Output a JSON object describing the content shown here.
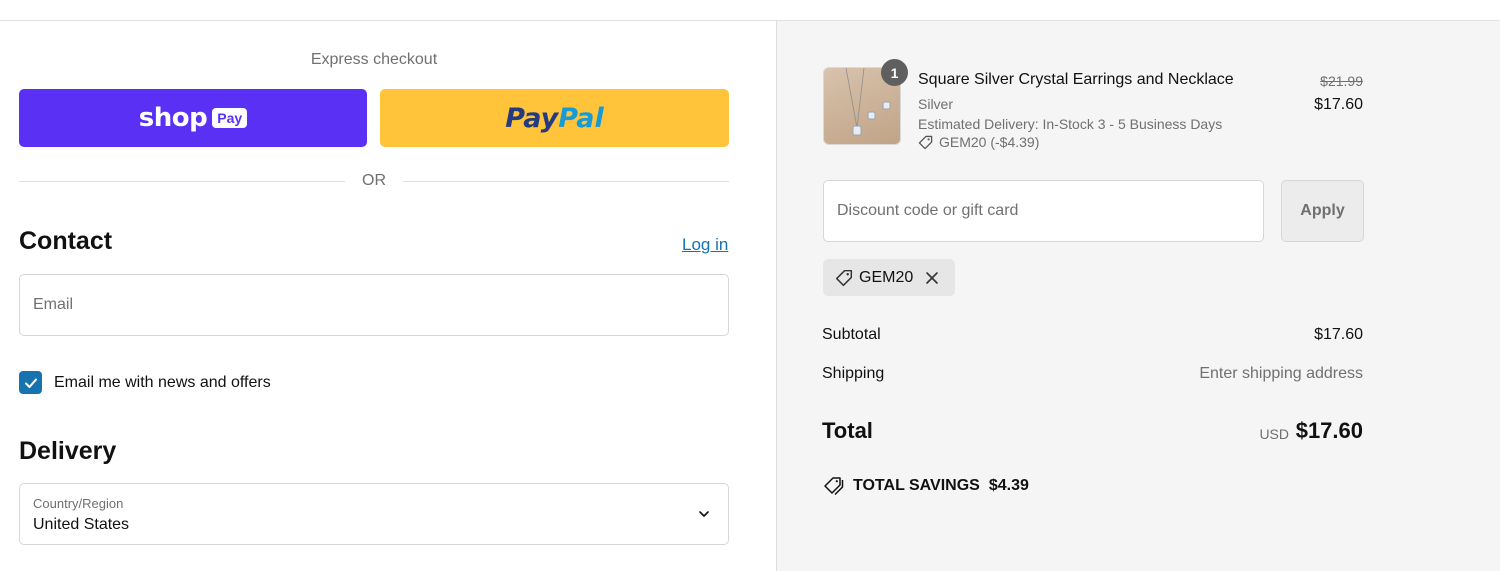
{
  "express": {
    "title": "Express checkout",
    "shop_pay_word": "shop",
    "shop_pay_badge": "Pay",
    "paypal_part1": "Pay",
    "paypal_part2": "Pal",
    "or": "OR"
  },
  "contact": {
    "title": "Contact",
    "login": "Log in",
    "email_placeholder": "Email",
    "newsletter_label": "Email me with news and offers",
    "newsletter_checked": true
  },
  "delivery": {
    "title": "Delivery",
    "country_label": "Country/Region",
    "country_value": "United States"
  },
  "order": {
    "item": {
      "quantity": "1",
      "name": "Square Silver Crystal Earrings and Necklace",
      "variant": "Silver",
      "delivery_note": "Estimated Delivery: In-Stock 3 - 5 Business Days",
      "discount": "GEM20 (-$4.39)",
      "price_original": "$21.99",
      "price_final": "$17.60"
    },
    "discount_placeholder": "Discount code or gift card",
    "apply_label": "Apply",
    "applied_code": "GEM20",
    "subtotal_label": "Subtotal",
    "subtotal_value": "$17.60",
    "shipping_label": "Shipping",
    "shipping_value": "Enter shipping address",
    "total_label": "Total",
    "currency": "USD",
    "total_value": "$17.60",
    "savings_label": "TOTAL SAVINGS",
    "savings_value": "$4.39"
  },
  "colors": {
    "shop_pay": "#5a31f4",
    "paypal": "#ffc439",
    "link": "#1773b0",
    "summary_bg": "#f5f5f5"
  },
  "icons": [
    "checkmark-icon",
    "chevron-down-icon",
    "tag-icon",
    "close-icon",
    "savings-tag-icon"
  ]
}
